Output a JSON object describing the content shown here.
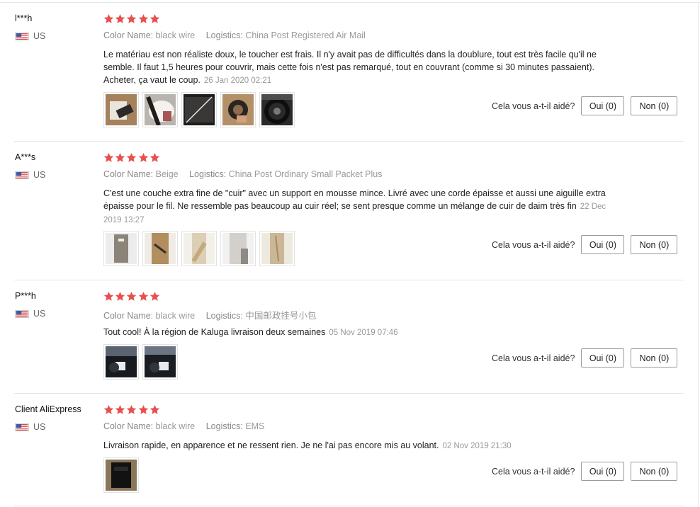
{
  "labels": {
    "color_name": "Color Name:",
    "logistics": "Logistics:",
    "helpful_question": "Cela vous a-t-il aidé?"
  },
  "colors": {
    "star": "#e84f4f",
    "separator": "#e6e6e6"
  },
  "reviews": [
    {
      "user": "l***h",
      "country": "US",
      "rating": 5,
      "color_name": "black wire",
      "logistics": "China Post Registered Air Mail",
      "text": "Le matériau est non réaliste doux, le toucher est frais. Il n'y avait pas de difficultés dans la doublure, tout est très facile qu'il ne semble. Il faut 1,5 heures pour couvrir, mais cette fois n'est pas remarqué, tout en couvrant (comme si 30 minutes passaient). Acheter, ça vaut le coup.",
      "date": "26 Jan 2020 02:21",
      "photo_count": 5,
      "yes_label": "Oui (0)",
      "no_label": "Non (0)"
    },
    {
      "user": "A***s",
      "country": "US",
      "rating": 5,
      "color_name": "Beige",
      "logistics": "China Post Ordinary Small Packet Plus",
      "text": "C'est une couche extra fine de \"cuir\" avec un support en mousse mince. Livré avec une corde épaisse et aussi une aiguille extra épaisse pour le fil. Ne ressemble pas beaucoup au cuir réel; se sent presque comme un mélange de cuir de daim très fin",
      "date": "22 Dec 2019 13:27",
      "photo_count": 5,
      "yes_label": "Oui (0)",
      "no_label": "Non (0)"
    },
    {
      "user": "P***h",
      "country": "US",
      "rating": 5,
      "color_name": "black wire",
      "logistics": "中国邮政挂号小包",
      "text": "Tout cool! À la région de Kaluga livraison deux semaines",
      "date": "05 Nov 2019 07:46",
      "photo_count": 2,
      "yes_label": "Oui (0)",
      "no_label": "Non (0)"
    },
    {
      "user": "Client AliExpress",
      "country": "US",
      "rating": 5,
      "color_name": "black wire",
      "logistics": "EMS",
      "text": "Livraison rapide, en apparence et ne ressent rien. Je ne l'ai pas encore mis au volant.",
      "date": "02 Nov 2019 21:30",
      "photo_count": 1,
      "yes_label": "Oui (0)",
      "no_label": "Non (0)"
    }
  ]
}
